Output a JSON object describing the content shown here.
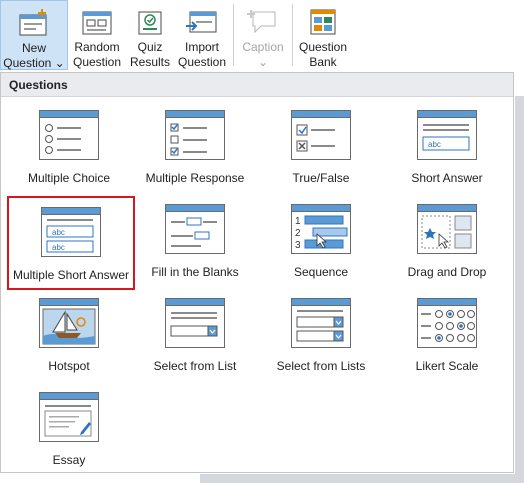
{
  "ribbon": {
    "buttons": [
      {
        "line1": "New",
        "line2": "Question ⌄"
      },
      {
        "line1": "Random",
        "line2": "Question"
      },
      {
        "line1": "Quiz",
        "line2": "Results"
      },
      {
        "line1": "Import",
        "line2": "Question"
      },
      {
        "line1": "Caption",
        "line2": "⌄"
      },
      {
        "line1": "Question",
        "line2": "Bank"
      }
    ]
  },
  "panel": {
    "header": "Questions",
    "tiles": [
      {
        "label": "Multiple Choice",
        "icon": "multiple-choice-icon"
      },
      {
        "label": "Multiple Response",
        "icon": "multiple-response-icon"
      },
      {
        "label": "True/False",
        "icon": "true-false-icon"
      },
      {
        "label": "Short Answer",
        "icon": "short-answer-icon"
      },
      {
        "label": "Multiple Short Answer",
        "icon": "multiple-short-answer-icon",
        "field1": "abc",
        "field2": "abc"
      },
      {
        "label": "Fill in the Blanks",
        "icon": "fill-in-blanks-icon"
      },
      {
        "label": "Sequence",
        "icon": "sequence-icon",
        "n1": "1",
        "n2": "2",
        "n3": "3"
      },
      {
        "label": "Drag and Drop",
        "icon": "drag-and-drop-icon"
      },
      {
        "label": "Hotspot",
        "icon": "hotspot-icon"
      },
      {
        "label": "Select from List",
        "icon": "select-from-list-icon"
      },
      {
        "label": "Select from Lists",
        "icon": "select-from-lists-icon"
      },
      {
        "label": "Likert Scale",
        "icon": "likert-scale-icon"
      },
      {
        "label": "Essay",
        "icon": "essay-icon"
      }
    ],
    "short_answer_field": "abc"
  },
  "colors": {
    "accent": "#2f74c0",
    "icon_bar": "#5b9bd5",
    "selection_outline": "#d8161d",
    "active_button": "#cfe3f7"
  }
}
